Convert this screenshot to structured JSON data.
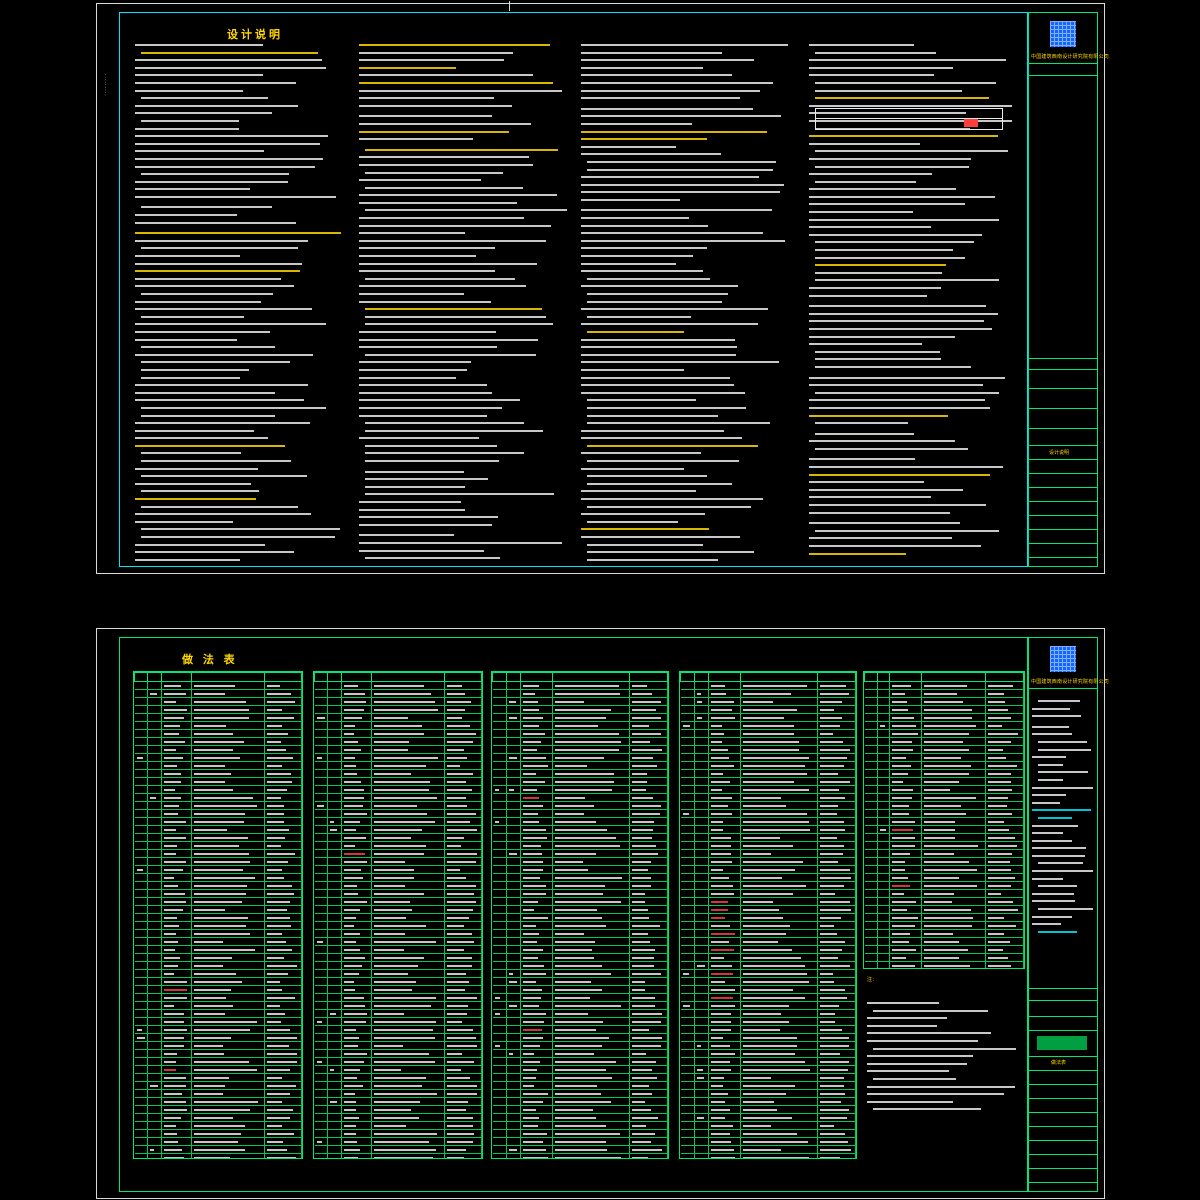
{
  "sheet1": {
    "title": "设计说明",
    "company": "中国建筑西南设计研究院有限公司",
    "drawing_name": "设计说明"
  },
  "sheet2": {
    "title": "做 法 表",
    "company": "中国建筑西南设计研究院有限公司",
    "drawing_name": "做法表",
    "note_label": "注："
  },
  "colors": {
    "frame": "#d9d9d9",
    "inner_border": "#00e5ff",
    "table_lines": "#00e676",
    "heading": "#ffd600",
    "text": "#eaeaea",
    "highlight": "#ff3d3d",
    "logo": "#1565ff"
  }
}
